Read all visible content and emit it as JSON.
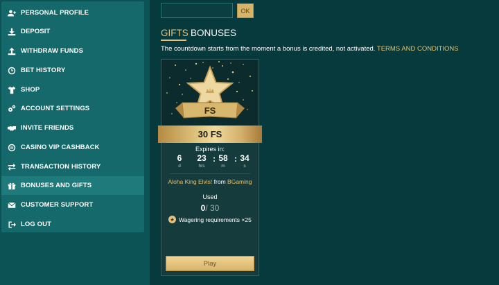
{
  "sidebar": {
    "items": [
      {
        "label": "PERSONAL PROFILE",
        "icon": "user-plus-icon"
      },
      {
        "label": "DEPOSIT",
        "icon": "download-icon"
      },
      {
        "label": "WITHDRAW FUNDS",
        "icon": "upload-icon"
      },
      {
        "label": "BET HISTORY",
        "icon": "clock-icon"
      },
      {
        "label": "SHOP",
        "icon": "shirt-icon"
      },
      {
        "label": "ACCOUNT SETTINGS",
        "icon": "gears-icon"
      },
      {
        "label": "INVITE FRIENDS",
        "icon": "handshake-icon"
      },
      {
        "label": "CASINO VIP CASHBACK",
        "icon": "cashback-icon"
      },
      {
        "label": "TRANSACTION HISTORY",
        "icon": "exchange-icon"
      },
      {
        "label": "BONUSES AND GIFTS",
        "icon": "gift-icon",
        "active": true
      },
      {
        "label": "CUSTOMER SUPPORT",
        "icon": "envelope-icon"
      },
      {
        "label": "LOG OUT",
        "icon": "logout-icon"
      }
    ]
  },
  "promo": {
    "code_value": "",
    "ok_label": "OK"
  },
  "tabs": {
    "gifts": "GIFTS",
    "bonuses": "BONUSES"
  },
  "notice": {
    "text": "The countdown starts from the moment a bonus is credited, not activated. ",
    "terms_link": "TERMS AND CONDITIONS"
  },
  "card": {
    "badge_text": "FS",
    "value": "30 FS",
    "expires_label": "Expires in:",
    "timer": {
      "days": "6",
      "days_label": "d",
      "hours": "23",
      "hours_label": "hrs",
      "minutes": "58",
      "minutes_label": "m",
      "seconds": "34",
      "seconds_label": "s"
    },
    "game_name": "Aloha King Elvis!",
    "from_word": " from ",
    "provider": "BGaming",
    "used_label": "Used",
    "used_now": "0",
    "used_total": "/ 30",
    "wagering_text": "Wagering requirements ×25",
    "play_label": "Play"
  },
  "colors": {
    "background": "#063a3c",
    "sidebar": "#15696a",
    "gold": "#e3c17d"
  }
}
